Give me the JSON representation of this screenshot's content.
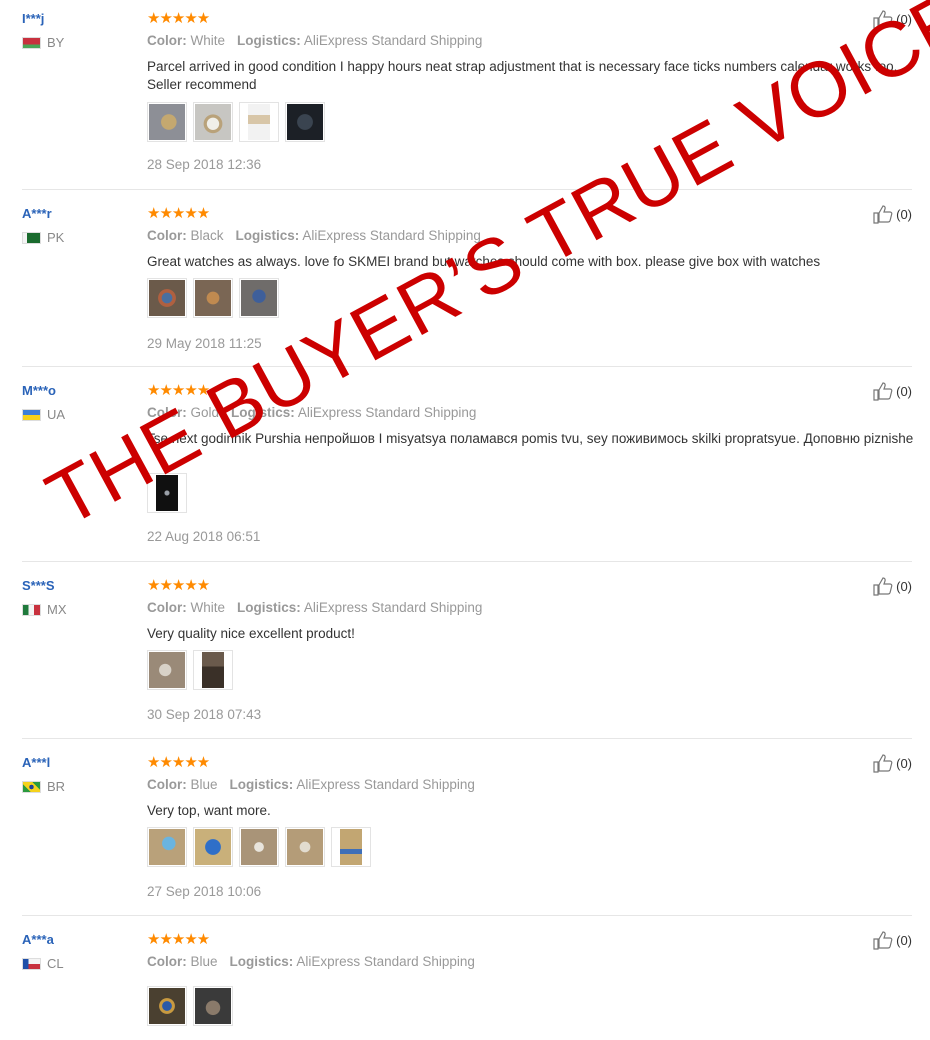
{
  "reviews": [
    {
      "user": "I***j",
      "country": "BY",
      "stars": "★★★★★",
      "color_label": "Color:",
      "color_value": "White",
      "logistics_label": "Logistics:",
      "logistics_value": "AliExpress Standard Shipping",
      "text": "Parcel arrived in good condition I happy hours neat strap adjustment that is necessary face ticks numbers calendar works too... Seller recommend",
      "photos": [
        "#8d8f96",
        "#c7c6c2",
        "#d8c6a8",
        "#1c2026"
      ],
      "date": "28 Sep 2018 12:36",
      "likes": "(0)"
    },
    {
      "user": "A***r",
      "country": "PK",
      "stars": "★★★★★",
      "color_label": "Color:",
      "color_value": "Black",
      "logistics_label": "Logistics:",
      "logistics_value": "AliExpress Standard Shipping",
      "text": "Great watches as always. love fo SKMEI brand but watches should come with box. please give box with watches",
      "photos": [
        "#6b5a4a",
        "#7a6654",
        "#6f6c6a"
      ],
      "date": "29 May 2018 11:25",
      "likes": "(0)"
    },
    {
      "user": "M***o",
      "country": "UA",
      "stars": "★★★★★",
      "color_label": "Color:",
      "color_value": "Gold",
      "logistics_label": "Logistics:",
      "logistics_value": "AliExpress Standard Shipping",
      "text": "Tse next godinnik Purshia непройшов I misyatsya поламався pomis tvu, sey поживимось skilki propratsyue. Доповню piznishe",
      "photos": [
        "#101010"
      ],
      "date": "22 Aug 2018 06:51",
      "likes": "(0)"
    },
    {
      "user": "S***S",
      "country": "MX",
      "stars": "★★★★★",
      "color_label": "Color:",
      "color_value": "White",
      "logistics_label": "Logistics:",
      "logistics_value": "AliExpress Standard Shipping",
      "text": "Very quality nice excellent product!",
      "photos": [
        "#9a8a78",
        "#6a5a4c"
      ],
      "date": "30 Sep 2018 07:43",
      "likes": "(0)"
    },
    {
      "user": "A***l",
      "country": "BR",
      "stars": "★★★★★",
      "color_label": "Color:",
      "color_value": "Blue",
      "logistics_label": "Logistics:",
      "logistics_value": "AliExpress Standard Shipping",
      "text": "Very top, want more.",
      "photos": [
        "#b9a17a",
        "#c9b07a",
        "#a99478",
        "#b49c78",
        "#c2a672"
      ],
      "date": "27 Sep 2018 10:06",
      "likes": "(0)"
    },
    {
      "user": "A***a",
      "country": "CL",
      "stars": "★★★★★",
      "color_label": "Color:",
      "color_value": "Blue",
      "logistics_label": "Logistics:",
      "logistics_value": "AliExpress Standard Shipping",
      "text": "",
      "photos": [
        "#4a4030",
        "#3a3a3a"
      ],
      "date": "",
      "likes": "(0)"
    }
  ],
  "watermark": "THE BUYER’S TRUE VOICE",
  "colors": {
    "accent": "#2a63b8",
    "stars": "#ff8a00",
    "watermark": "#cc0000"
  },
  "icons": {
    "like": "thumbs-up-icon"
  }
}
